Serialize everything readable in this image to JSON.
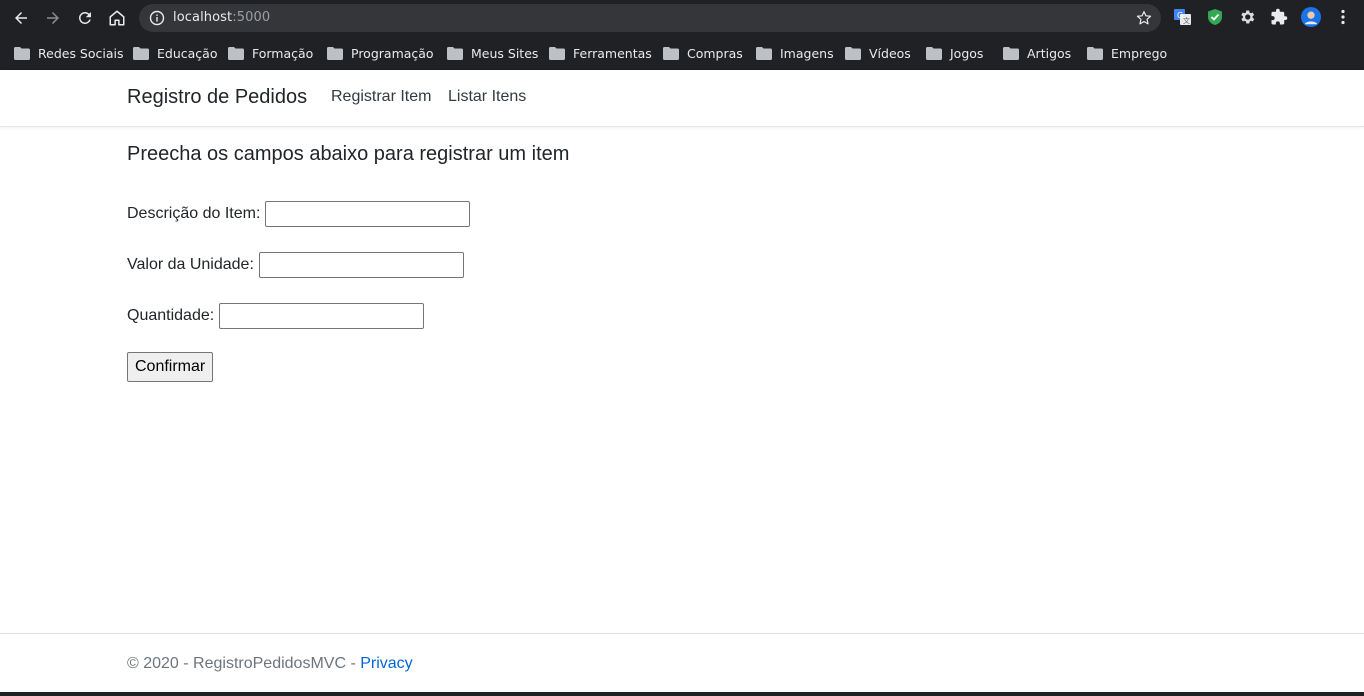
{
  "browser": {
    "url_host": "localhost",
    "url_port": ":5000",
    "bookmarks": [
      {
        "label": "Redes Sociais"
      },
      {
        "label": "Educação"
      },
      {
        "label": "Formação"
      },
      {
        "label": "Programação"
      },
      {
        "label": "Meus Sites"
      },
      {
        "label": "Ferramentas"
      },
      {
        "label": "Compras"
      },
      {
        "label": "Imagens"
      },
      {
        "label": "Vídeos"
      },
      {
        "label": "Jogos"
      },
      {
        "label": "Artigos"
      },
      {
        "label": "Emprego"
      }
    ]
  },
  "nav": {
    "brand": "Registro de Pedidos",
    "links": [
      {
        "label": "Registrar Item"
      },
      {
        "label": "Listar Itens"
      }
    ]
  },
  "form": {
    "heading": "Preecha os campos abaixo para registrar um item",
    "fields": [
      {
        "label": "Descrição do Item:",
        "value": ""
      },
      {
        "label": "Valor da Unidade:",
        "value": ""
      },
      {
        "label": "Quantidade:",
        "value": ""
      }
    ],
    "submit_label": "Confirmar"
  },
  "footer": {
    "text": "© 2020 - RegistroPedidosMVC - ",
    "link": "Privacy"
  }
}
